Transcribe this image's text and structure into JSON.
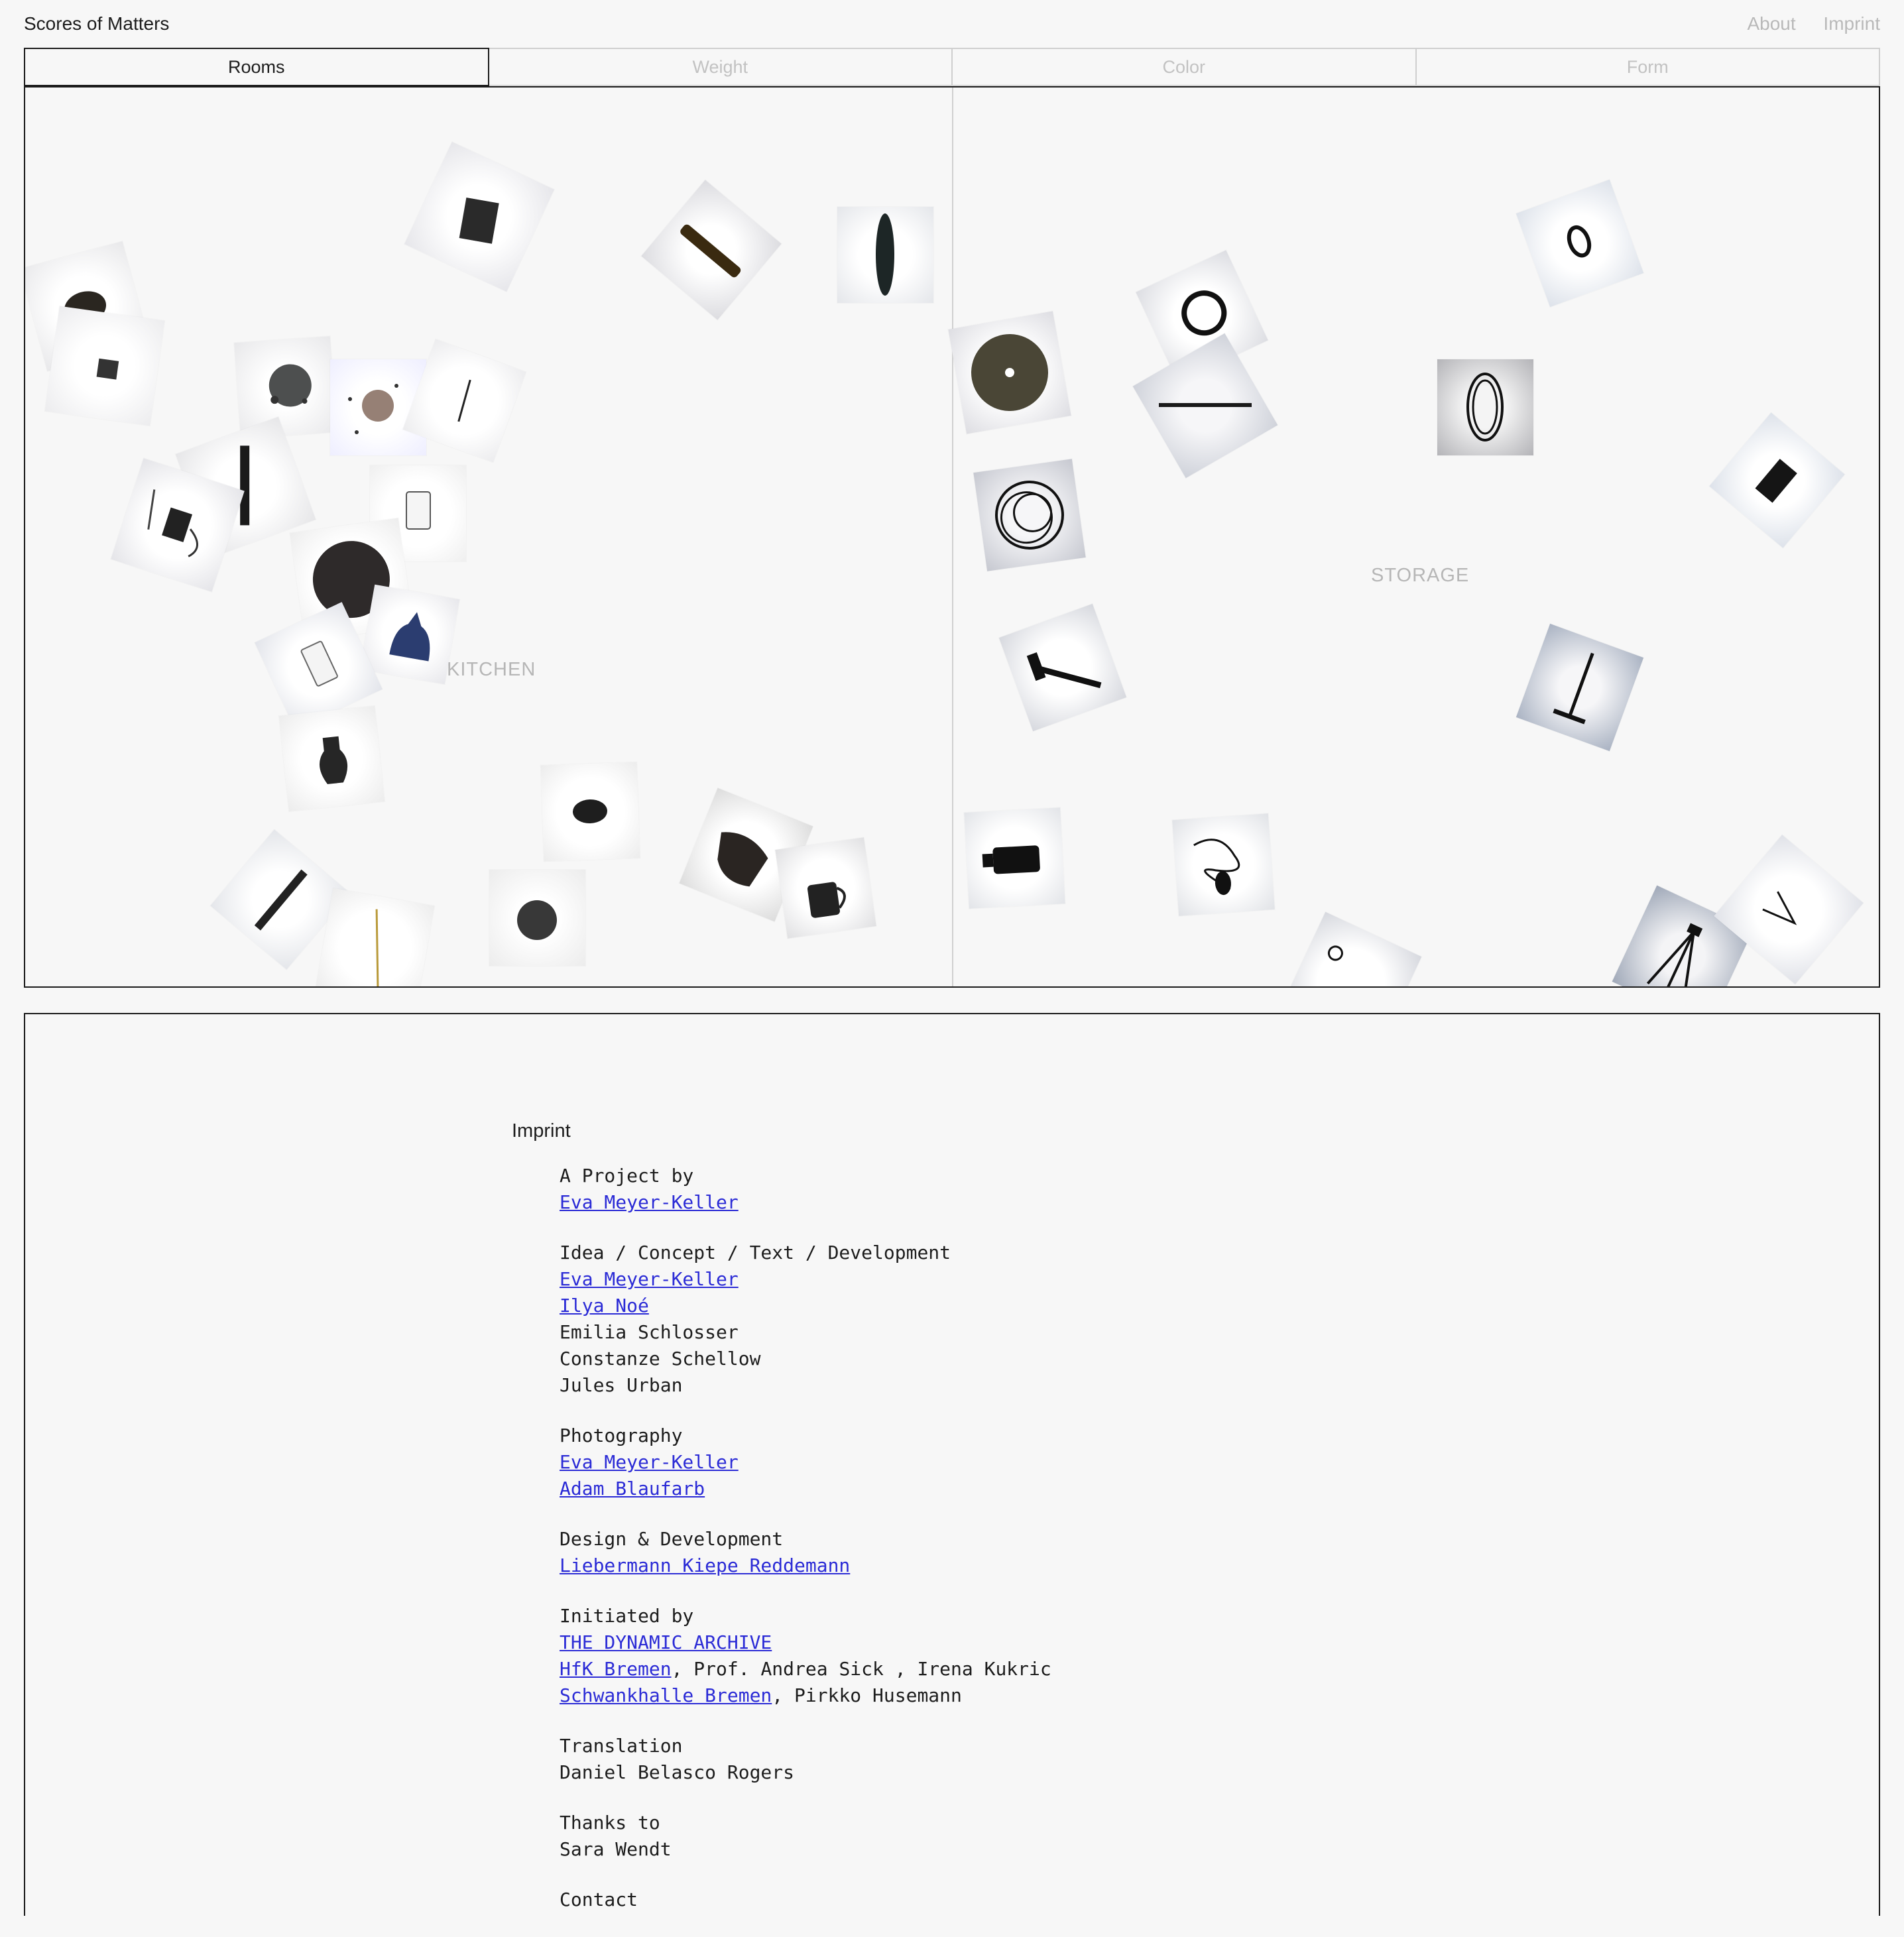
{
  "site": {
    "title": "Scores of Matters"
  },
  "nav": {
    "about": "About",
    "imprint": "Imprint"
  },
  "tabs": [
    "Rooms",
    "Weight",
    "Color",
    "Form"
  ],
  "rooms": {
    "left": "KITCHEN",
    "right": "STORAGE"
  },
  "imprint": {
    "title": "Imprint",
    "project_label": "A Project by",
    "project_link": "Eva Meyer-Keller",
    "idea_label": "Idea / Concept / Text / Development",
    "idea_link1": "Eva Meyer-Keller",
    "idea_link2": "Ilya Noé",
    "idea_name3": "Emilia Schlosser",
    "idea_name4": "Constanze Schellow",
    "idea_name5": "Jules Urban",
    "photo_label": "Photography",
    "photo_link1": "Eva Meyer-Keller",
    "photo_link2": "Adam Blaufarb",
    "design_label": "Design & Development",
    "design_link": "Liebermann Kiepe Reddemann",
    "init_label": "Initiated by",
    "init_link1": "THE DYNAMIC ARCHIVE",
    "init_link2": "HfK Bremen",
    "init_rest2": ", Prof. Andrea Sick , Irena Kukric",
    "init_link3": "Schwankhalle Bremen",
    "init_rest3": ", Pirkko Husemann",
    "trans_label": "Translation",
    "trans_name": "Daniel Belasco Rogers",
    "thanks_label": "Thanks to",
    "thanks_name": "Sara Wendt",
    "contact_label": "Contact"
  }
}
